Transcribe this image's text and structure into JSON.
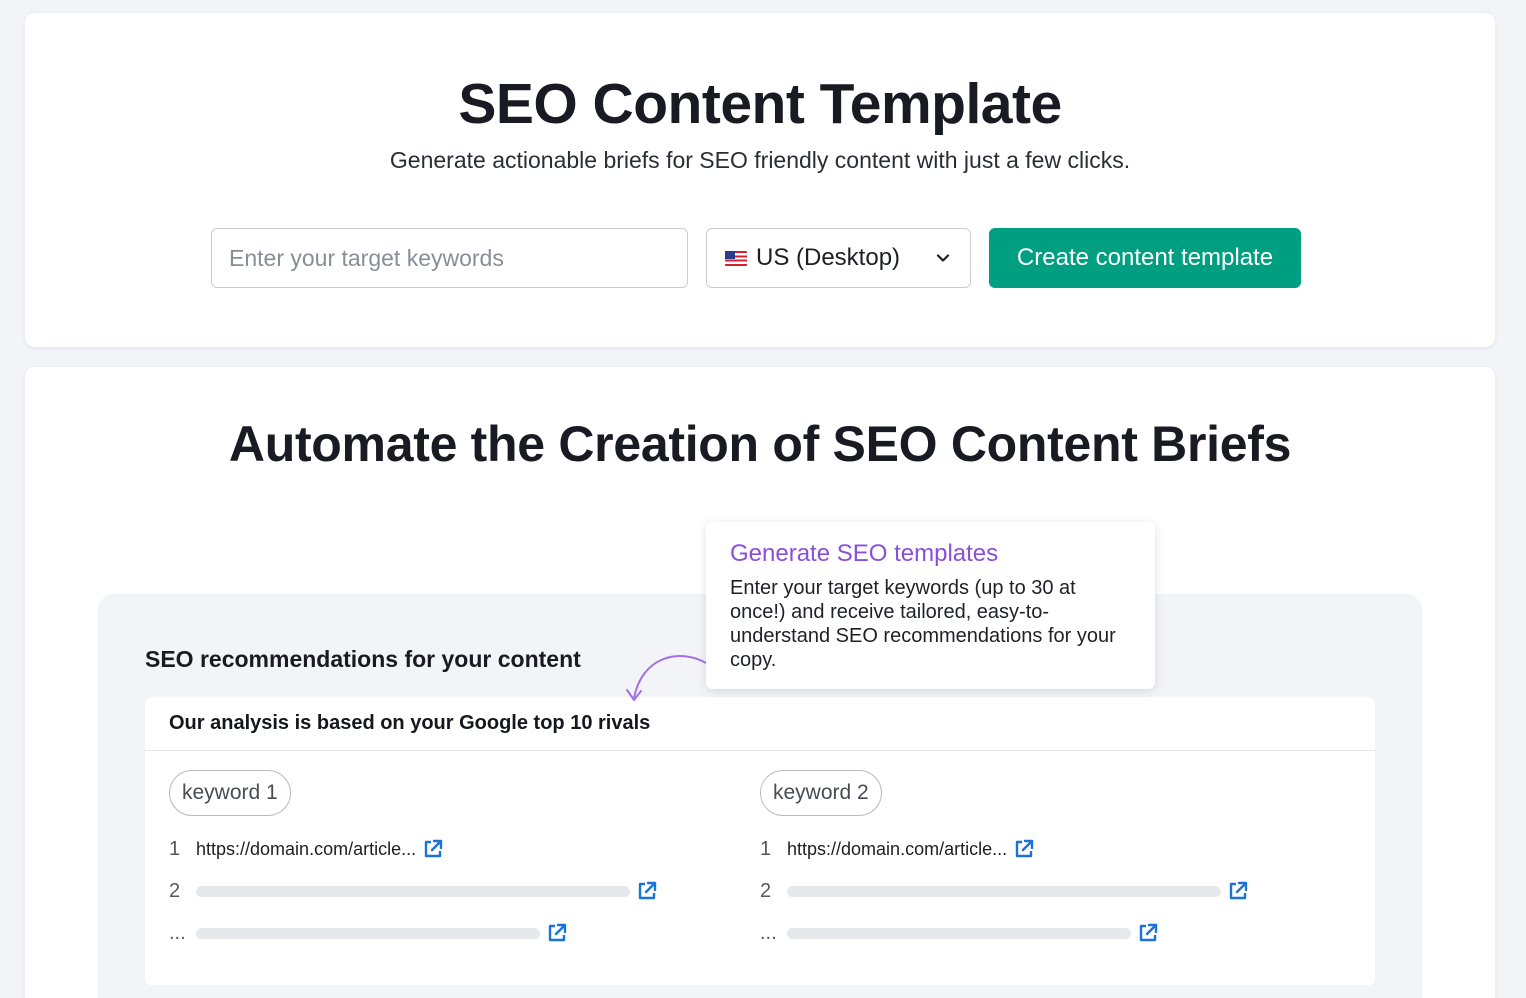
{
  "header": {
    "title": "SEO Content Template",
    "subtitle": "Generate actionable briefs for SEO friendly content with just a few clicks."
  },
  "search": {
    "placeholder": "Enter your target keywords",
    "value": ""
  },
  "database_select": {
    "flag_icon": "us-flag-icon",
    "label": "US (Desktop)"
  },
  "create_button": {
    "label": "Create content template",
    "color": "#009f81"
  },
  "feature": {
    "title": "Automate the Creation of SEO Content Briefs"
  },
  "tooltip": {
    "title": "Generate SEO templates",
    "body": "Enter your target keywords (up to 30 at once!) and receive tailored, easy-to-understand SEO recommendations for your copy.",
    "title_color": "#8a4fd9"
  },
  "preview": {
    "heading": "SEO recommendations for your content",
    "panel_heading": "Our analysis is based on your Google top 10 rivals",
    "columns": [
      {
        "keyword": "keyword 1",
        "rows": [
          {
            "rank": "1",
            "url": "https://domain.com/article..."
          },
          {
            "rank": "2"
          },
          {
            "rank": "..."
          }
        ]
      },
      {
        "keyword": "keyword 2",
        "rows": [
          {
            "rank": "1",
            "url": "https://domain.com/article..."
          },
          {
            "rank": "2"
          },
          {
            "rank": "..."
          }
        ]
      }
    ]
  }
}
